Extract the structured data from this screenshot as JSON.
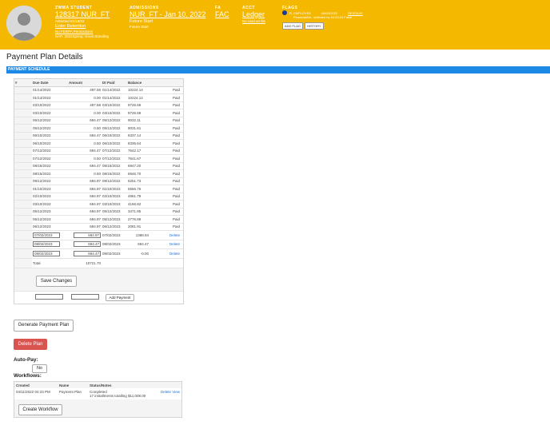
{
  "header": {
    "student_label": "ZWMA STUDENT",
    "student_id": "128317 NUR_FT",
    "admitted": "Admitted 01/18/22",
    "enter_retention": "Enter Retention",
    "ferpa": "No FERPA Permissions",
    "sap": "SAP: 2022Spring: Good Standing",
    "admissions_label": "ADMISSIONS",
    "admissions_value": "NUR_FT - Jan 10, 2022",
    "future_start_1": "Future Start",
    "future_start_2": "Future Start",
    "fa_label": "FA",
    "fa_value": "FAC",
    "acct_label": "ACCT",
    "acct_value": "Ledger",
    "no_card": "No card on file",
    "flags_label": "FLAGS",
    "flag_text": "R. EMPLOYEE",
    "flag_date": "06/03/2022",
    "flag_resolve": "RESOLVE",
    "flag_sub": "FinancialAid - selected by 04:23:24 False",
    "add_flag": "ADD FLAG",
    "history": "HISTORY"
  },
  "page_title": "Payment Plan Details",
  "schedule_title": "PAYMENT SCHEDULE",
  "columns": [
    "#",
    "Due Date",
    "Amount",
    "Dt Paid",
    "Balance"
  ],
  "rows": [
    {
      "due": "01/14/2022",
      "amount": "497.58",
      "paid": "01/14/2022",
      "balance": "10224.14",
      "status": "Paid"
    },
    {
      "due": "01/14/2022",
      "amount": "0.00",
      "paid": "01/14/2022",
      "balance": "10224.14",
      "status": "Paid"
    },
    {
      "due": "03/10/2022",
      "amount": "497.58",
      "paid": "03/10/2022",
      "balance": "9726.59",
      "status": "Paid"
    },
    {
      "due": "03/10/2022",
      "amount": "0.00",
      "paid": "03/10/2022",
      "balance": "9726.59",
      "status": "Paid"
    },
    {
      "due": "05/12/2022",
      "amount": "694.47",
      "paid": "05/12/2022",
      "balance": "9032.11",
      "status": "Paid"
    },
    {
      "due": "05/12/2022",
      "amount": "0.50",
      "paid": "05/12/2022",
      "balance": "9031.61",
      "status": "Paid"
    },
    {
      "due": "06/10/2022",
      "amount": "694.47",
      "paid": "06/10/2022",
      "balance": "8337.14",
      "status": "Paid"
    },
    {
      "due": "06/10/2022",
      "amount": "0.50",
      "paid": "06/10/2022",
      "balance": "8336.64",
      "status": "Paid"
    },
    {
      "due": "07/12/2022",
      "amount": "694.47",
      "paid": "07/12/2022",
      "balance": "7642.17",
      "status": "Paid"
    },
    {
      "due": "07/12/2022",
      "amount": "0.50",
      "paid": "07/12/2022",
      "balance": "7641.67",
      "status": "Paid"
    },
    {
      "due": "08/15/2022",
      "amount": "694.47",
      "paid": "08/15/2022",
      "balance": "6947.20",
      "status": "Paid"
    },
    {
      "due": "08/15/2022",
      "amount": "0.50",
      "paid": "08/15/2022",
      "balance": "6946.70",
      "status": "Paid"
    },
    {
      "due": "09/12/2022",
      "amount": "694.97",
      "paid": "09/12/2022",
      "balance": "6251.73",
      "status": "Paid"
    },
    {
      "due": "01/10/2023",
      "amount": "694.97",
      "paid": "01/10/2023",
      "balance": "5556.76",
      "status": "Paid"
    },
    {
      "due": "02/10/2023",
      "amount": "694.97",
      "paid": "02/10/2023",
      "balance": "4861.79",
      "status": "Paid"
    },
    {
      "due": "03/10/2023",
      "amount": "694.97",
      "paid": "03/10/2023",
      "balance": "4166.82",
      "status": "Paid"
    },
    {
      "due": "05/12/2023",
      "amount": "694.97",
      "paid": "05/12/2023",
      "balance": "3471.85",
      "status": "Paid"
    },
    {
      "due": "05/12/2023",
      "amount": "694.97",
      "paid": "05/12/2023",
      "balance": "2776.88",
      "status": "Paid"
    },
    {
      "due": "06/12/2023",
      "amount": "694.97",
      "paid": "06/12/2023",
      "balance": "2081.91",
      "status": "Paid"
    }
  ],
  "edit_rows": [
    {
      "due": "07/02/2023",
      "amount": "692.97",
      "paid": "07/02/2023",
      "balance": "1388.94",
      "action": "Delete"
    },
    {
      "due": "08/02/2023",
      "amount": "694.47",
      "paid": "08/02/2023",
      "balance": "694.47",
      "action": "Delete"
    },
    {
      "due": "09/02/2023",
      "amount": "694.47",
      "paid": "09/02/2023",
      "balance": "-0.00",
      "action": "Delete"
    }
  ],
  "total_label": "Total",
  "total_value": "10721.70",
  "save_changes": "Save Changes",
  "add_payment": "Add Payment",
  "generate_plan": "Generate Payment Plan",
  "delete_plan": "Delete Plan",
  "auto_pay_label": "Auto-Pay:",
  "auto_pay_value": "No",
  "workflows_label": "Workflows:",
  "workflow_columns": [
    "Created",
    "Name",
    "Status/Notes"
  ],
  "workflow_row": {
    "created": "04/11/2022 04:23 PM",
    "name": "Payment Plan",
    "status": "Completed",
    "notes": "17 installments totalling $11,008.00",
    "delete": "Delete",
    "view": "View"
  },
  "create_workflow": "Create Workflow",
  "colors": {
    "header": "#f5b800",
    "bar": "#1e88e5",
    "danger": "#d9534f",
    "link": "#1e6fd0"
  }
}
